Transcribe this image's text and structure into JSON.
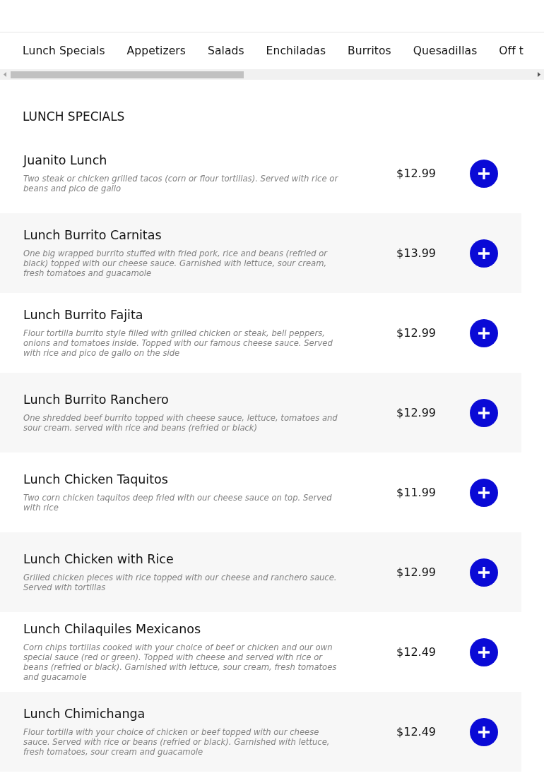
{
  "tabs": [
    {
      "label": "Lunch Specials"
    },
    {
      "label": "Appetizers"
    },
    {
      "label": "Salads"
    },
    {
      "label": "Enchiladas"
    },
    {
      "label": "Burritos"
    },
    {
      "label": "Quesadillas"
    },
    {
      "label": "Off t"
    }
  ],
  "section": {
    "title": "LUNCH SPECIALS"
  },
  "items": [
    {
      "name": "Juanito Lunch",
      "description": "Two steak or chicken grilled tacos (corn or flour tortillas). Served with rice or beans and pico de gallo",
      "price": "$12.99"
    },
    {
      "name": "Lunch Burrito Carnitas",
      "description": "One big wrapped burrito stuffed with fried pork, rice and beans (refried or black) topped with our cheese sauce. Garnished with lettuce, sour cream, fresh tomatoes and guacamole",
      "price": "$13.99"
    },
    {
      "name": "Lunch Burrito Fajita",
      "description": "Flour tortilla burrito style filled with grilled chicken or steak, bell peppers, onions and tomatoes inside. Topped with our famous cheese sauce. Served with rice and pico de gallo on the side",
      "price": "$12.99"
    },
    {
      "name": "Lunch Burrito Ranchero",
      "description": "One shredded beef burrito topped with cheese sauce, lettuce, tomatoes and sour cream. served with rice and beans (refried or black)",
      "price": "$12.99"
    },
    {
      "name": "Lunch Chicken Taquitos",
      "description": "Two corn chicken taquitos deep fried with our cheese sauce on top. Served with rice",
      "price": "$11.99"
    },
    {
      "name": "Lunch Chicken with Rice",
      "description": "Grilled chicken pieces with rice topped with our cheese and ranchero sauce. Served with tortillas",
      "price": "$12.99"
    },
    {
      "name": "Lunch Chilaquiles Mexicanos",
      "description": "Corn chips tortillas cooked with your choice of beef or chicken and our own special sauce (red or green). Topped with cheese and served with rice or beans (refried or black). Garnished with lettuce, sour cream, fresh tomatoes and guacamole",
      "price": "$12.49"
    },
    {
      "name": "Lunch Chimichanga",
      "description": "Flour tortilla with your choice of chicken or beef topped with our cheese sauce. Served with rice or beans (refried or black). Garnished with lettuce, fresh tomatoes, sour cream and guacamole",
      "price": "$12.49"
    }
  ]
}
